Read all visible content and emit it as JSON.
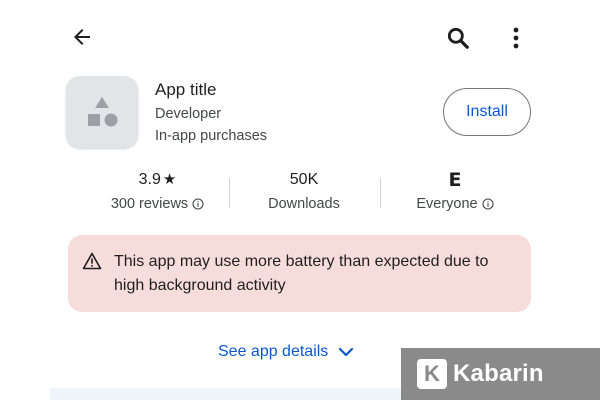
{
  "header": {
    "back_icon": "arrow-back-icon",
    "search_icon": "search-icon",
    "more_icon": "more-vert-icon"
  },
  "app": {
    "title": "App title",
    "developer": "Developer",
    "purchases": "In-app purchases",
    "install_label": "Install"
  },
  "stats": {
    "rating_value": "3.9",
    "rating_star": "★",
    "reviews_label": "300 reviews",
    "downloads_value": "50K",
    "downloads_label": "Downloads",
    "age_badge": "E",
    "age_label": "Everyone"
  },
  "warning": {
    "text": "This app may use more battery than expected due to high background activity"
  },
  "details": {
    "label": "See app details"
  },
  "watermark": {
    "logo_letter": "K",
    "text": "Kabarin"
  },
  "colors": {
    "accent": "#0b57d0",
    "warning_bg": "#f7dcdc",
    "icon_bg": "#e3e4e8"
  }
}
